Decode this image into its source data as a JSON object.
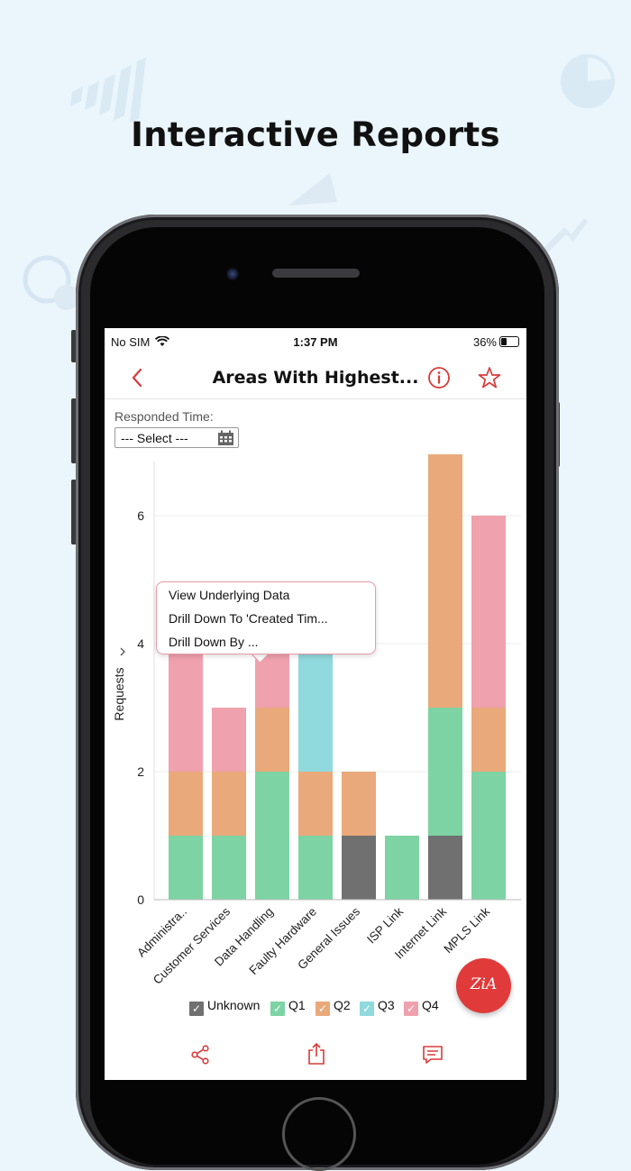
{
  "headline": "Interactive Reports",
  "status_bar": {
    "carrier": "No SIM",
    "time": "1:37 PM",
    "battery": "36%"
  },
  "nav": {
    "title": "Areas With Highest..."
  },
  "filter": {
    "label": "Responded Time:",
    "select_value": "--- Select ---"
  },
  "context_menu": {
    "items": [
      "View Underlying Data",
      "Drill Down To 'Created Tim...",
      "Drill Down By ..."
    ]
  },
  "colors": {
    "unknown": "#707070",
    "q1": "#7dd3a3",
    "q2": "#e9a97a",
    "q3": "#90d9dc",
    "q4": "#f0a1ae",
    "accent": "#d93a3a"
  },
  "chart_data": {
    "type": "bar",
    "stacked": true,
    "ylabel": "Requests",
    "ylim": [
      0,
      7
    ],
    "yticks": [
      0,
      2,
      4,
      6
    ],
    "categories": [
      "Administra..",
      "Customer Services",
      "Data Handling",
      "Faulty Hardware",
      "General Issues",
      "ISP Link",
      "Internet Link",
      "MPLS Link"
    ],
    "series": [
      {
        "name": "Unknown",
        "values": [
          0,
          0,
          0,
          0,
          1,
          0,
          1,
          0
        ]
      },
      {
        "name": "Q1",
        "values": [
          1,
          1,
          2,
          1,
          0,
          1,
          2,
          2
        ]
      },
      {
        "name": "Q2",
        "values": [
          1,
          1,
          1,
          1,
          1,
          0,
          4,
          1
        ]
      },
      {
        "name": "Q3",
        "values": [
          0,
          0,
          0,
          2,
          0,
          0,
          0,
          0
        ]
      },
      {
        "name": "Q4",
        "values": [
          2,
          1,
          1,
          0,
          0,
          0,
          0,
          3
        ]
      }
    ],
    "legend": [
      "Unknown",
      "Q1",
      "Q2",
      "Q3",
      "Q4"
    ],
    "legend_position": "bottom",
    "grid": true
  },
  "zia_label": "ZiA",
  "icons": [
    "chevron-left-icon",
    "info-icon",
    "star-icon",
    "calendar-icon",
    "share-icon",
    "export-icon",
    "comment-icon",
    "zia-icon"
  ]
}
